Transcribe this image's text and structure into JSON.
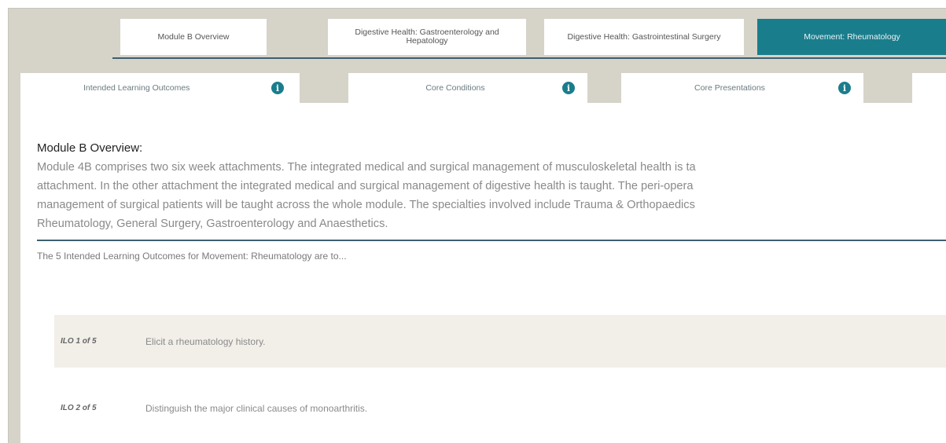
{
  "module_tabs": [
    {
      "label": "Module B Overview",
      "active": false
    },
    {
      "label": "Digestive Health: Gastroenterology and Hepatology",
      "active": false
    },
    {
      "label": "Digestive Health: Gastrointestinal Surgery",
      "active": false
    },
    {
      "label": "Movement: Rheumatology",
      "active": true
    }
  ],
  "sub_tabs": [
    {
      "label": "Intended Learning Outcomes",
      "icon": "info-icon"
    },
    {
      "label": "Core Conditions",
      "icon": "info-icon"
    },
    {
      "label": "Core Presentations",
      "icon": "info-icon"
    }
  ],
  "overview": {
    "title": "Module B Overview:",
    "lines": [
      "Module 4B comprises two six week attachments. The integrated medical and surgical management of musculoskeletal health is ta",
      "attachment. In the other attachment the integrated medical and surgical management of digestive health is taught. The peri-opera",
      "management of surgical patients will be taught across the whole module. The specialties involved include Trauma & Orthopaedics",
      "Rheumatology, General Surgery, Gastroenterology and Anaesthetics."
    ]
  },
  "ilo_intro": "The 5 Intended Learning Outcomes for Movement: Rheumatology are to...",
  "ilos": [
    {
      "num": "ILO 1 of 5",
      "text": "Elicit a rheumatology history."
    },
    {
      "num": "ILO 2 of 5",
      "text": "Distinguish the major clinical causes of monoarthritis."
    }
  ],
  "colors": {
    "accent": "#1a7d8c",
    "frame_bg": "#d6d3c9",
    "rule": "#3f5f70",
    "ilo_row_bg": "#f2efe9"
  }
}
